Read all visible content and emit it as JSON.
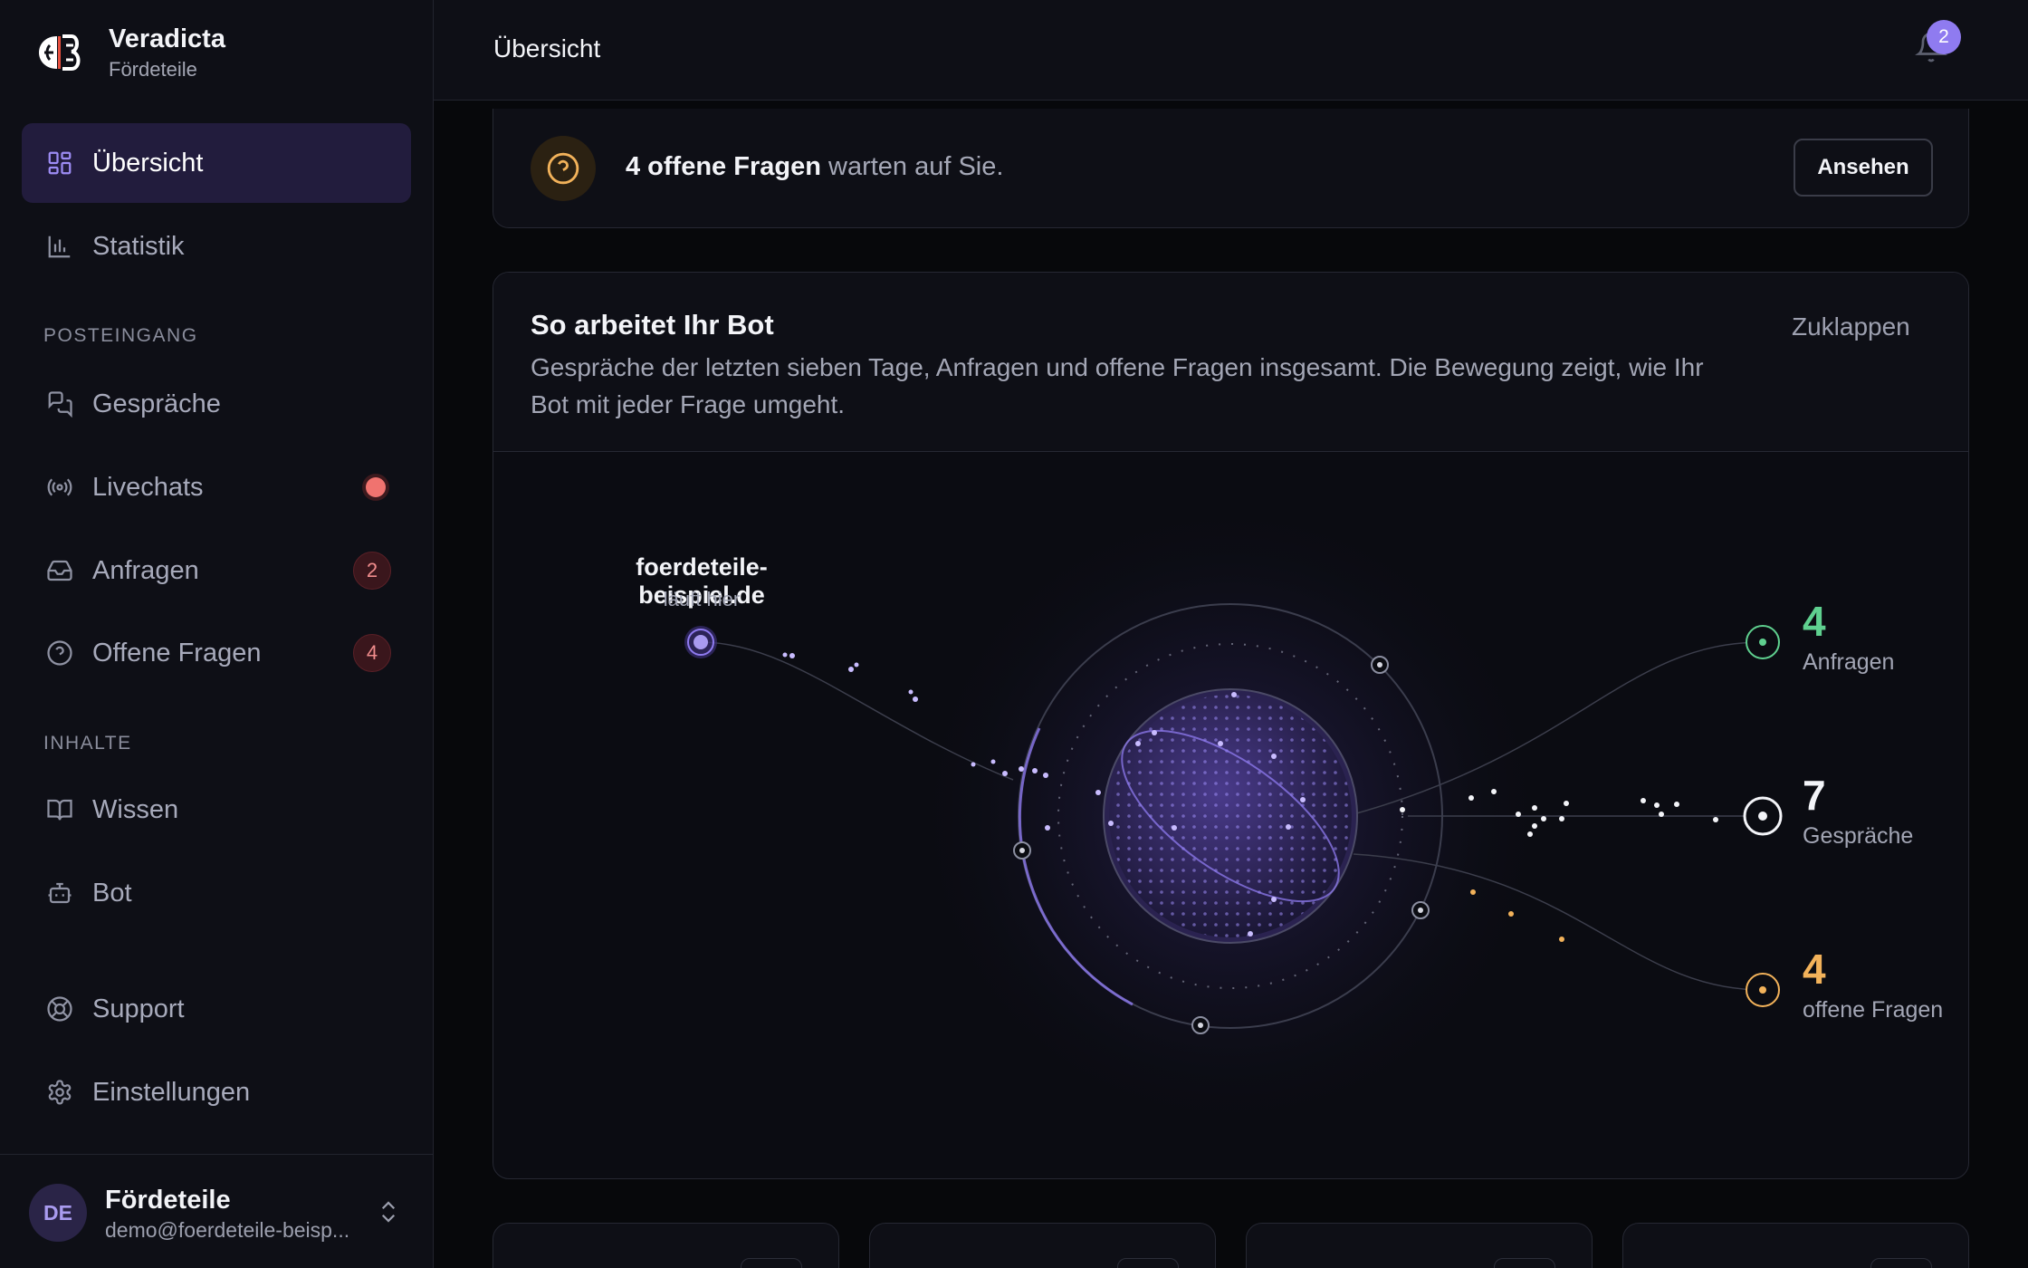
{
  "brand": {
    "name": "Veradicta",
    "subtitle": "Fördeteile"
  },
  "sidebar": {
    "items": [
      {
        "label": "Übersicht",
        "icon": "dashboard-grid-icon",
        "active": true
      },
      {
        "label": "Statistik",
        "icon": "bar-chart-icon"
      }
    ],
    "sections": [
      {
        "title": "POSTEINGANG",
        "items": [
          {
            "label": "Gespräche",
            "icon": "chat-bubbles-icon"
          },
          {
            "label": "Livechats",
            "icon": "broadcast-icon",
            "dot": true
          },
          {
            "label": "Anfragen",
            "icon": "inbox-icon",
            "badge": "2"
          },
          {
            "label": "Offene Fragen",
            "icon": "question-circle-icon",
            "badge": "4"
          }
        ]
      },
      {
        "title": "INHALTE",
        "items": [
          {
            "label": "Wissen",
            "icon": "book-icon"
          },
          {
            "label": "Bot",
            "icon": "robot-icon"
          }
        ]
      }
    ],
    "footer_items": [
      {
        "label": "Support",
        "icon": "lifebuoy-icon"
      },
      {
        "label": "Einstellungen",
        "icon": "gear-icon"
      }
    ]
  },
  "user": {
    "initials": "DE",
    "name": "Fördeteile",
    "email": "demo@foerdeteile-beisp..."
  },
  "topbar": {
    "title": "Übersicht",
    "notification_count": "2"
  },
  "alert": {
    "strong": "4 offene Fragen",
    "rest": " warten auf Sie.",
    "button": "Ansehen"
  },
  "bot_card": {
    "title": "So arbeitet Ihr Bot",
    "description": "Gespräche der letzten sieben Tage, Anfragen und offene Fragen insgesamt. Die Bewegung zeigt, wie Ihr Bot mit jeder Frage umgeht.",
    "collapse_label": "Zuklappen",
    "domain": "foerdeteile-beispiel.de",
    "domain_sub": "läuft hier",
    "stats": [
      {
        "value": "4",
        "label": "Anfragen",
        "color": "#5fd08f"
      },
      {
        "value": "7",
        "label": "Gespräche",
        "color": "#f3f4f8"
      },
      {
        "value": "4",
        "label": "offene Fragen",
        "color": "#f2b25a"
      }
    ]
  },
  "colors": {
    "accent": "#8f7bf0",
    "warning": "#f2b25a",
    "success": "#5fd08f",
    "danger": "#f0736f"
  }
}
